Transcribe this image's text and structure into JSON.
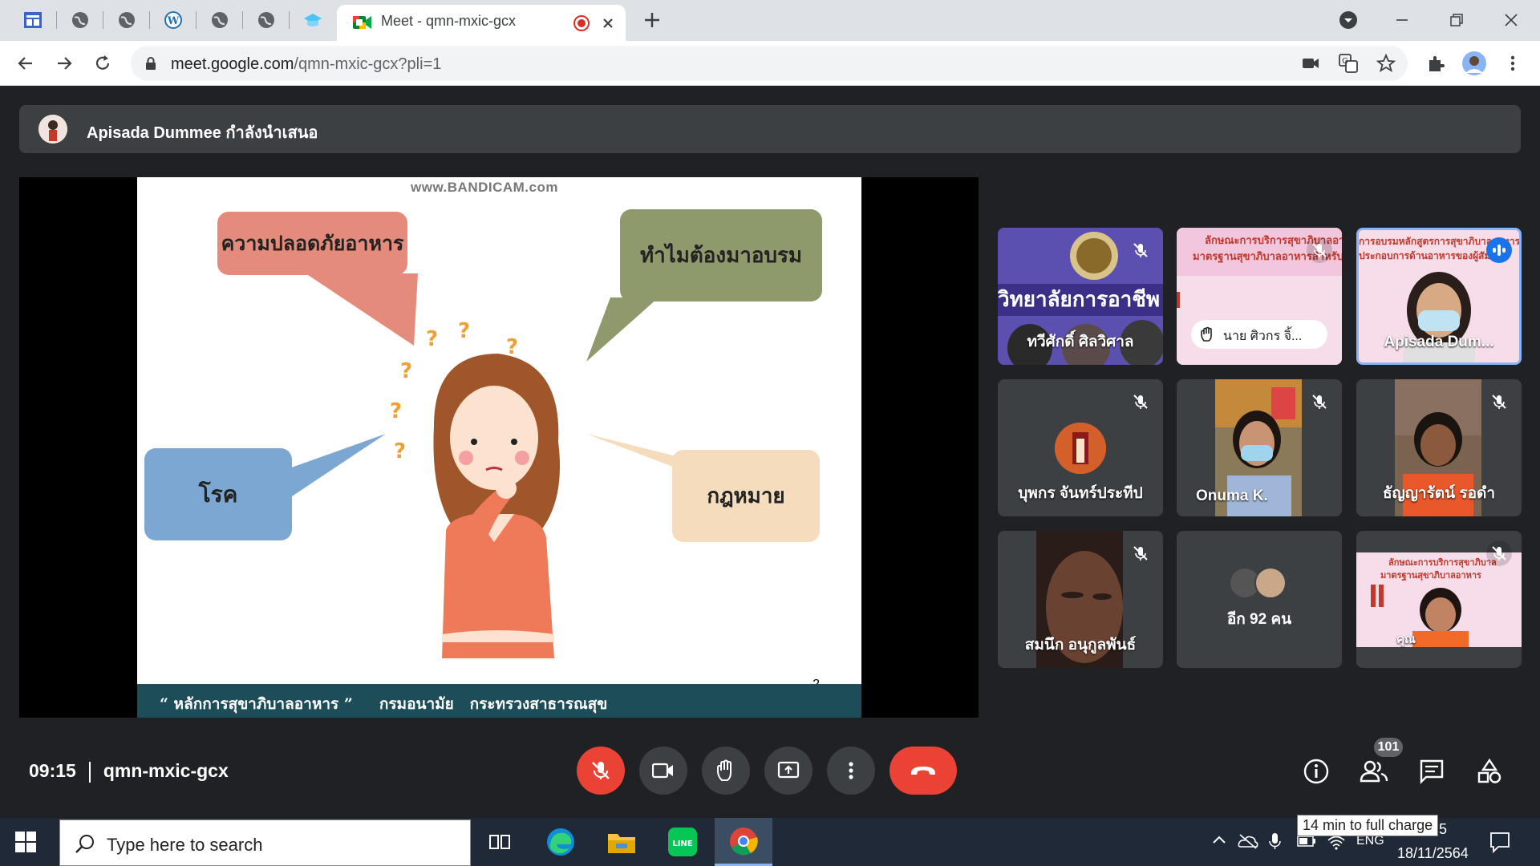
{
  "browser": {
    "active_tab_title": "Meet - qmn-mxic-gcx",
    "url_host": "meet.google.com",
    "url_path": "/qmn-mxic-gcx?pli=1"
  },
  "meet": {
    "presenting_text": "Apisada Dummee กำลังนำเสนอ",
    "meeting_time": "09:15",
    "meeting_code": "qmn-mxic-gcx",
    "people_count": "101",
    "colors": {
      "accent": "#8ab4f8",
      "danger": "#ea4335",
      "control_bg": "#3c4043",
      "page_bg": "#202124"
    }
  },
  "slide": {
    "watermark": "www.BANDICAM.com",
    "bubble_top_left": "ความปลอดภัยอาหาร",
    "bubble_top_right": "ทำไมต้องมาอบรม",
    "bubble_left": "โรค",
    "bubble_right": "กฎหมาย",
    "footer": "“ หลักการสุขาภิบาลอาหาร ”     กรมอนามัย   กระทรวงสาธารณสุข",
    "page_number": "2"
  },
  "participants": [
    {
      "name": "ทวีศักดิ์ ศิลวิศาล",
      "muted": true
    },
    {
      "name": "นาย ศิวกร จิ้...",
      "muted": true,
      "hand_raised": true
    },
    {
      "name": "Apisada Dum...",
      "speaking": true
    },
    {
      "name": "บุพกร จันทร์ประทีป",
      "muted": true
    },
    {
      "name": "Onuma K.",
      "muted": true
    },
    {
      "name": "ธัญญารัตน์ รอดำ",
      "muted": true
    },
    {
      "name": "สมนึก อนุกูลพันธ์",
      "muted": true
    },
    {
      "name": "อีก 92 คน"
    },
    {
      "name": "คุณ",
      "muted": true
    }
  ],
  "taskbar": {
    "search_placeholder": "Type here to search",
    "battery_tooltip": "14 min to full charge",
    "time_fragment": "5",
    "language": "ENG",
    "date": "18/11/2564"
  }
}
